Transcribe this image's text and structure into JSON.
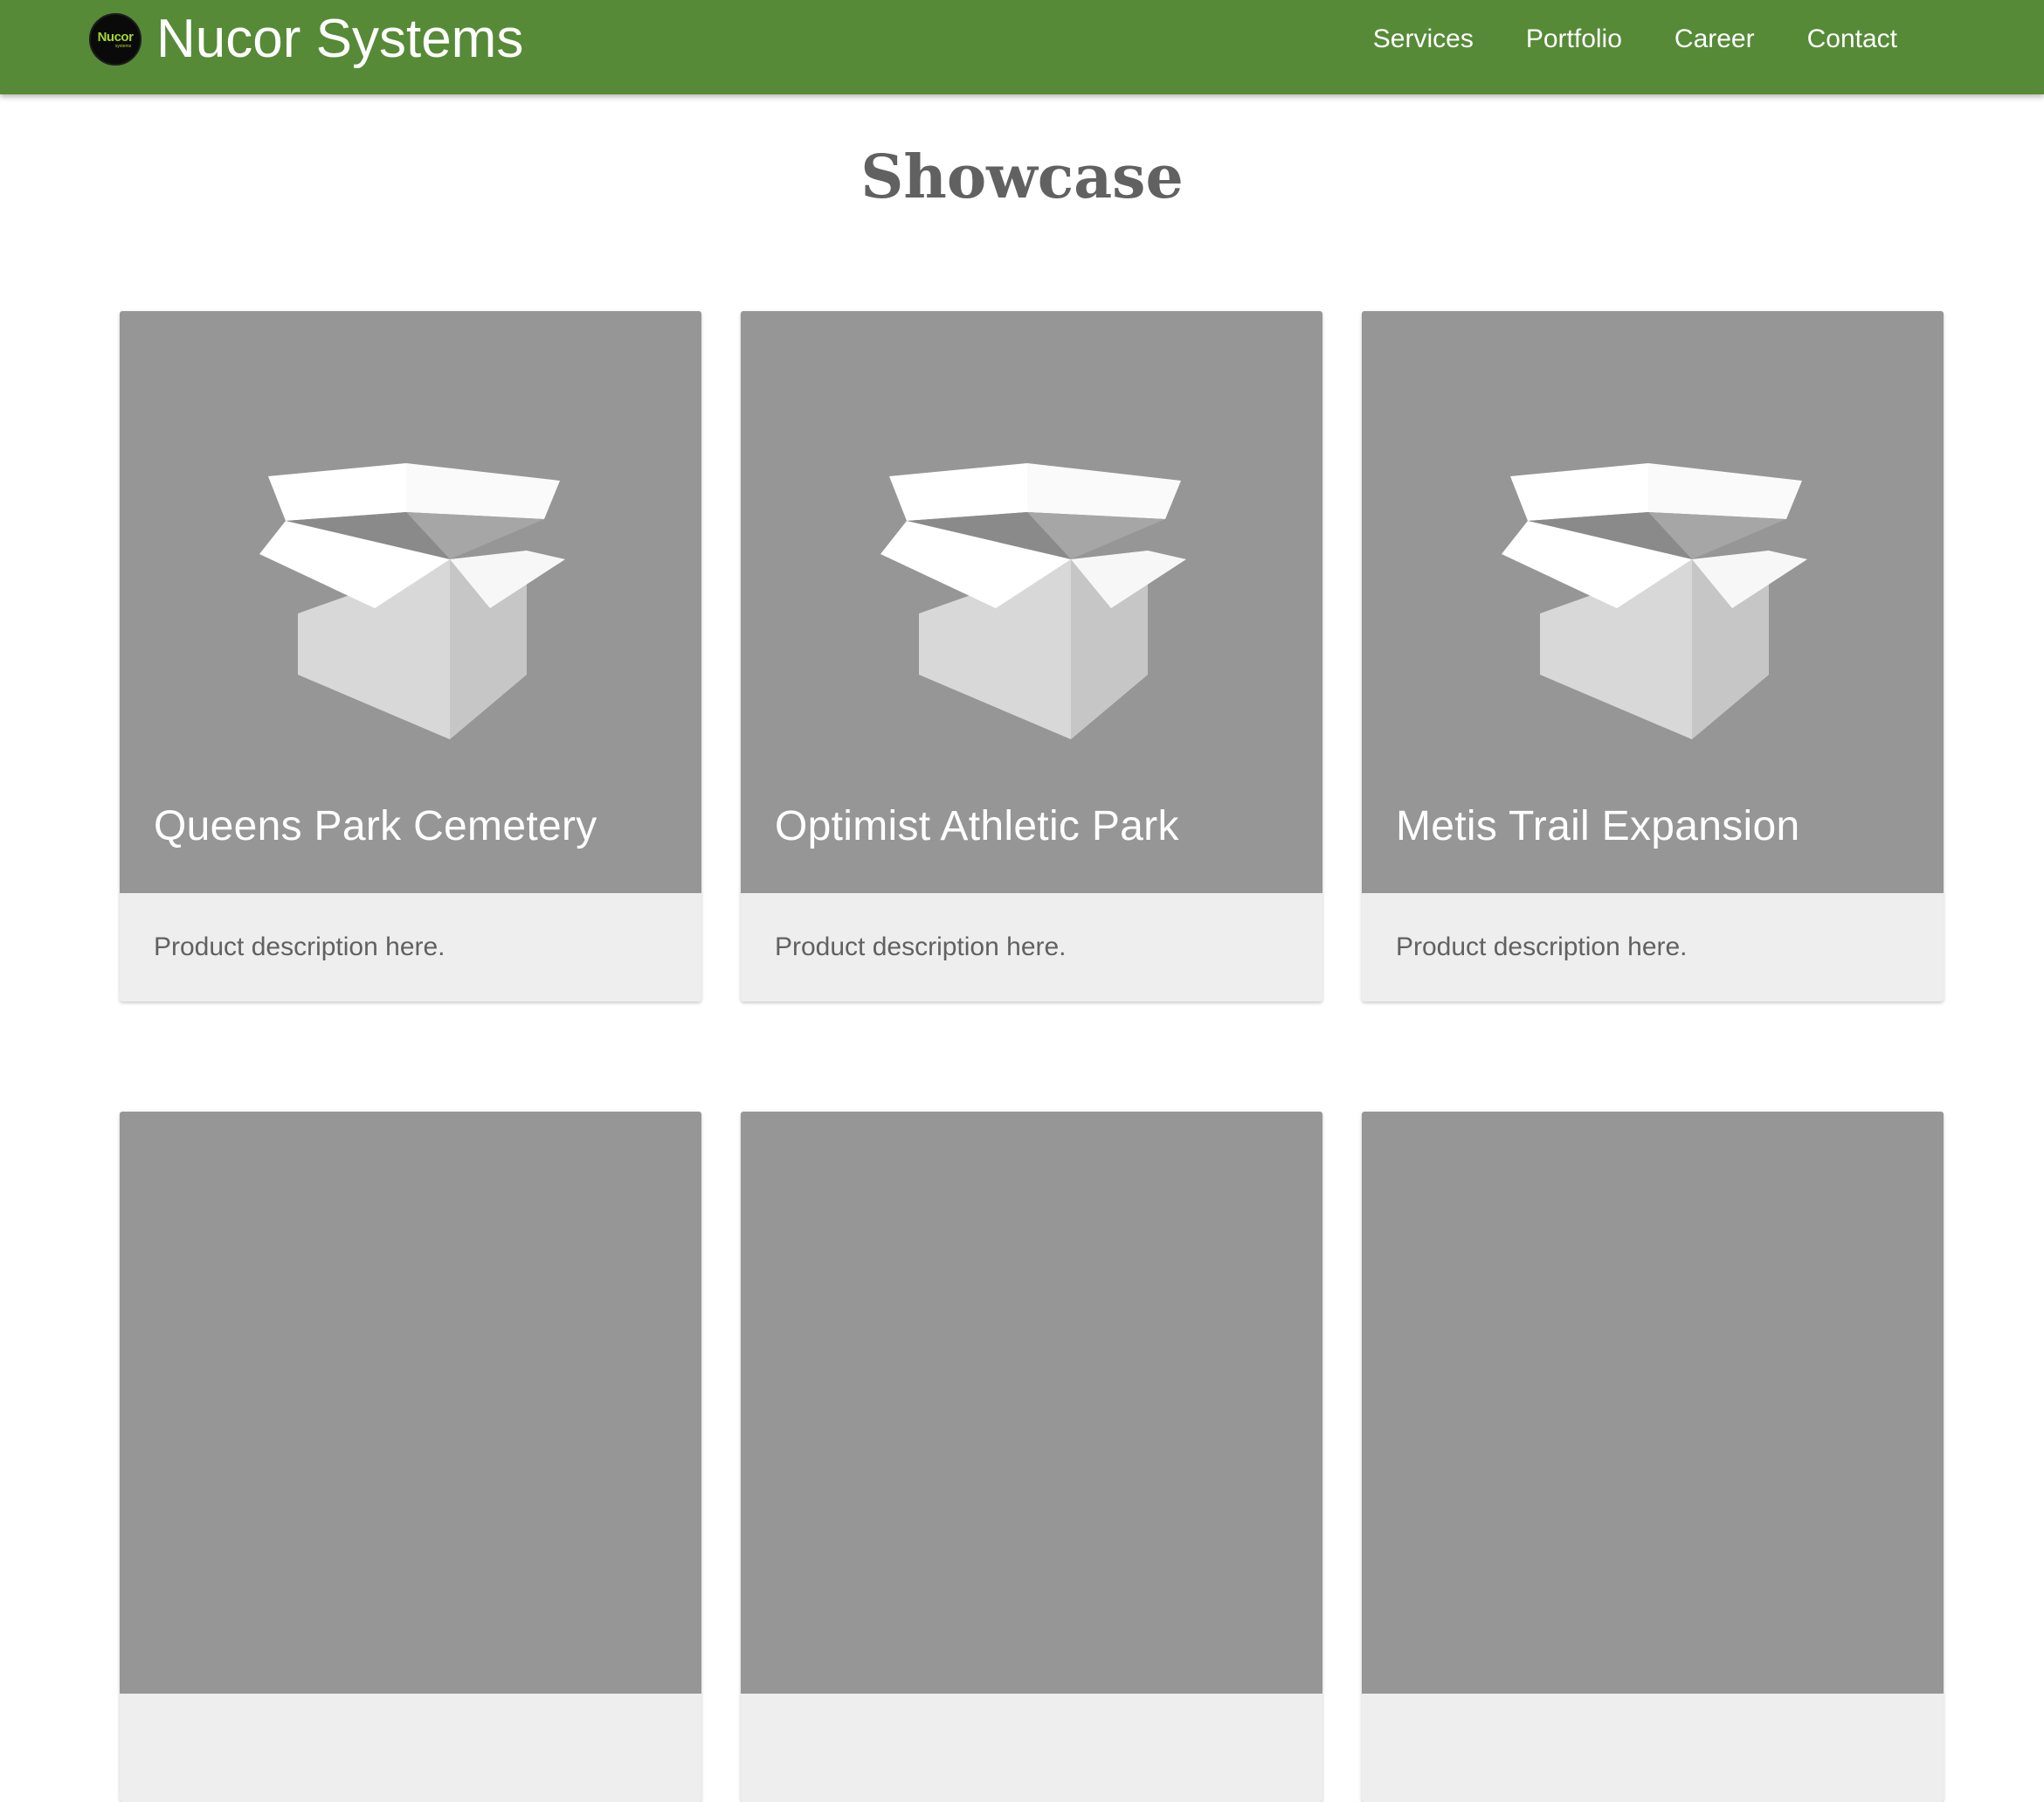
{
  "nav": {
    "logo_text": "Nucor",
    "logo_subtext": "systems",
    "brand": "Nucor Systems",
    "links": [
      "Services",
      "Portfolio",
      "Career",
      "Contact"
    ],
    "color": "#568a37"
  },
  "page": {
    "title": "Showcase"
  },
  "cards": [
    {
      "title": "Queens Park Cemetery",
      "description": "Product description here.",
      "icon": "open-box-icon"
    },
    {
      "title": "Optimist Athletic Park",
      "description": "Product description here.",
      "icon": "open-box-icon"
    },
    {
      "title": "Metis Trail Expansion",
      "description": "Product description here.",
      "icon": "open-box-icon"
    },
    {
      "title": "",
      "description": "",
      "icon": ""
    },
    {
      "title": "",
      "description": "",
      "icon": ""
    },
    {
      "title": "",
      "description": "",
      "icon": ""
    }
  ],
  "colors": {
    "card_media": "#969696",
    "card_body": "#eeeeee",
    "title_text": "#616161"
  }
}
